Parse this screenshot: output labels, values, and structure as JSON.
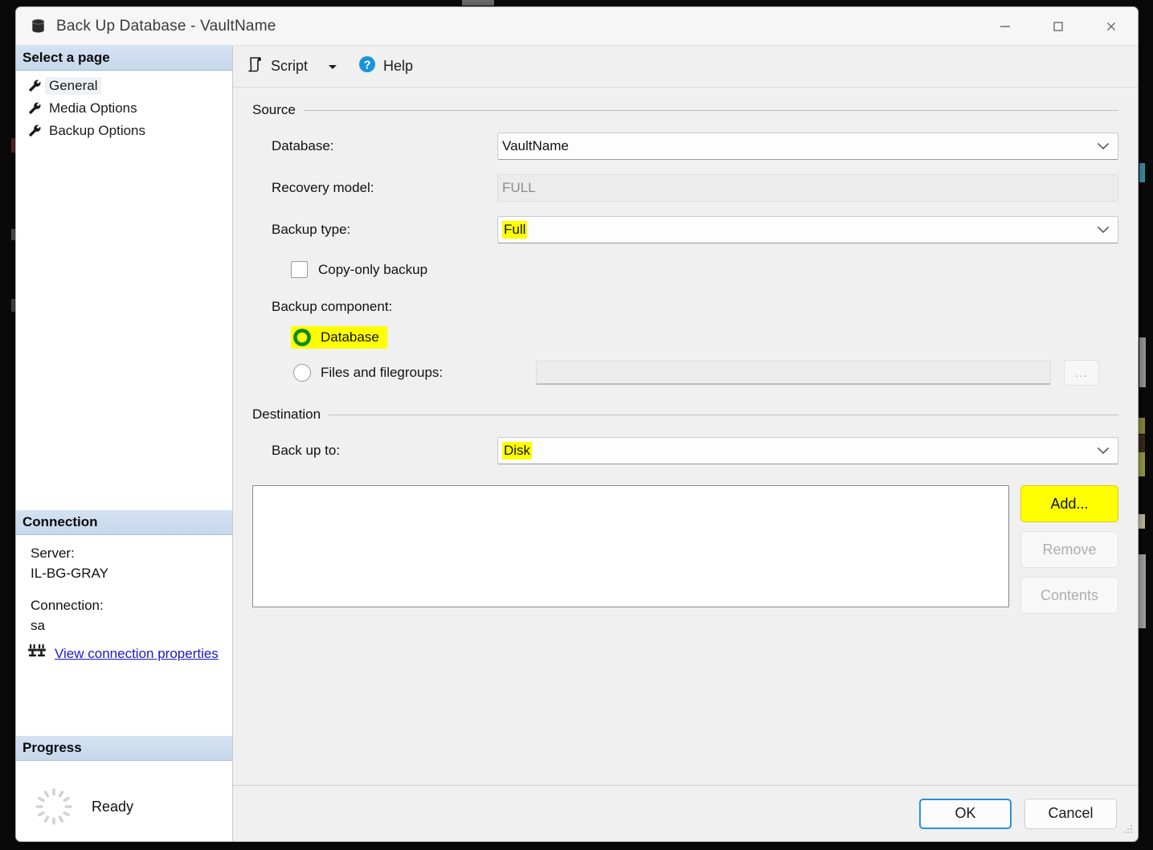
{
  "window": {
    "title": "Back Up Database - VaultName",
    "icon": "database-icon",
    "minimize_label": "—",
    "maximize_label": "□",
    "close_label": "✕"
  },
  "sidebar": {
    "pages_header": "Select a page",
    "pages": [
      {
        "label": "General",
        "icon": "wrench-icon",
        "selected": true
      },
      {
        "label": "Media Options",
        "icon": "wrench-icon",
        "selected": false
      },
      {
        "label": "Backup Options",
        "icon": "wrench-icon",
        "selected": false
      }
    ],
    "connection": {
      "header": "Connection",
      "server_label": "Server:",
      "server_value": "IL-BG-GRAY",
      "connection_label": "Connection:",
      "connection_value": "sa",
      "link_text": "View connection properties",
      "link_icon": "connection-plug-icon",
      "link_color": "#1a19c8"
    },
    "progress": {
      "header": "Progress",
      "status": "Ready",
      "spinner_icon": "loading-spinner-icon"
    }
  },
  "toolbar": {
    "script_label": "Script",
    "script_icon": "script-page-icon",
    "script_caret": "▾",
    "help_label": "Help",
    "help_icon": "help-question-icon",
    "help_icon_color": "#1a94d8"
  },
  "source": {
    "group_title": "Source",
    "database_label": "Database:",
    "database_value": "VaultName",
    "recovery_model_label": "Recovery model:",
    "recovery_model_value": "FULL",
    "backup_type_label": "Backup type:",
    "backup_type_value": "Full",
    "backup_type_highlighted": true,
    "copy_only_label": "Copy-only backup",
    "copy_only_checked": false,
    "backup_component_label": "Backup component:",
    "component_database_label": "Database",
    "component_database_selected": true,
    "component_database_highlighted": true,
    "component_database_radio_color": "#0a8a2a",
    "component_files_label": "Files and filegroups:",
    "component_files_selected": false,
    "component_files_value": "",
    "browse_button_label": "...",
    "caret": "⌄"
  },
  "destination": {
    "group_title": "Destination",
    "backup_to_label": "Back up to:",
    "backup_to_value": "Disk",
    "backup_to_highlighted": true,
    "list_items": [],
    "add_label": "Add...",
    "add_highlighted": true,
    "remove_label": "Remove",
    "remove_enabled": false,
    "contents_label": "Contents",
    "contents_enabled": false
  },
  "footer": {
    "ok_label": "OK",
    "cancel_label": "Cancel",
    "resize_grip_icon": "resize-grip-icon"
  },
  "colors": {
    "highlight": "#ffff00",
    "link": "#1a19c8",
    "accent_focus": "#2d8fd5",
    "radio_green": "#0a8a2a"
  }
}
